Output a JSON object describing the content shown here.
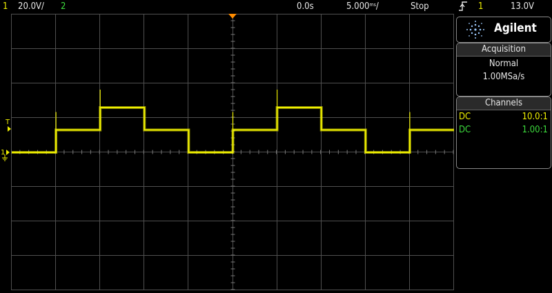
{
  "topbar": {
    "ch1_num": "1",
    "ch1_scale": "20.0V/",
    "ch2_num": "2",
    "time_offset": "0.0s",
    "time_scale": "5.000³/",
    "time_scale_text": "5.000",
    "time_scale_unit": "ms",
    "run_state": "Stop",
    "trigger_edge_icon": "rising-edge-icon",
    "trigger_source": "1",
    "trigger_level": "13.0V"
  },
  "brand": {
    "name": "Agilent",
    "logo_icon": "agilent-spark-icon"
  },
  "acquisition": {
    "title": "Acquisition",
    "mode": "Normal",
    "rate": "1.00MSa/s"
  },
  "channels": {
    "title": "Channels",
    "items": [
      {
        "coupling": "DC",
        "probe": "10.0:1",
        "color": "#f0f000"
      },
      {
        "coupling": "DC",
        "probe": "1.00:1",
        "color": "#3ddc3d"
      }
    ]
  },
  "markers": {
    "trigger_marker": "T",
    "ch1_marker": "1",
    "ground_icon": "ground-icon"
  },
  "colors": {
    "trace": "#f0f000",
    "grid": "#505050",
    "background": "#000000",
    "trigger_pos": "#ff8c00"
  },
  "chart_data": {
    "type": "line",
    "x_unit": "ms",
    "y_unit": "V",
    "grid": true,
    "x_divisions": 10,
    "y_divisions": 8,
    "series": [
      {
        "points": [
          [
            -25.0,
            0.0
          ],
          [
            -20.0,
            0.0
          ],
          [
            -20.0,
            20.0
          ],
          [
            -15.0,
            20.0
          ],
          [
            -15.0,
            40.0
          ],
          [
            -10.0,
            40.0
          ],
          [
            -10.0,
            20.0
          ],
          [
            -5.0,
            20.0
          ],
          [
            -5.0,
            0.0
          ],
          [
            0.0,
            0.0
          ],
          [
            0.0,
            20.0
          ],
          [
            5.0,
            20.0
          ],
          [
            5.0,
            40.0
          ],
          [
            10.0,
            40.0
          ],
          [
            10.0,
            20.0
          ],
          [
            15.0,
            20.0
          ],
          [
            15.0,
            0.0
          ],
          [
            20.0,
            0.0
          ],
          [
            20.0,
            20.0
          ],
          [
            25.0,
            20.0
          ]
        ]
      }
    ]
  }
}
